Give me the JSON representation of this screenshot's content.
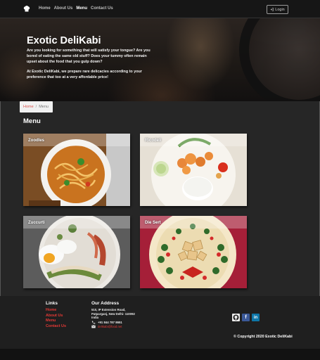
{
  "navbar": {
    "links": [
      {
        "label": "Home"
      },
      {
        "label": "About Us"
      },
      {
        "label": "Menu"
      },
      {
        "label": "Contact Us"
      }
    ],
    "login_label": "Login"
  },
  "hero": {
    "title": "Exotic DeliKabi",
    "paragraph1": "Are you looking for something that will satisfy your tongue? Are you bored of eating the same old stuff? Does your tummy often remain upset about the food that you gulp down?",
    "paragraph2": "At Exotic DeliKabi, we prepare rare delicacies according to your preference that too at a very affordable price!"
  },
  "breadcrumb": {
    "home": "Home",
    "separator": "/",
    "current": "Menu"
  },
  "menu": {
    "heading": "Menu",
    "items": [
      {
        "label": "Zoodles"
      },
      {
        "label": "Ricodeli"
      },
      {
        "label": "Zuccurti"
      },
      {
        "label": "Die Sert"
      }
    ]
  },
  "footer": {
    "links_title": "Links",
    "links": [
      "Home",
      "About Us",
      "Menu",
      "Contact Us"
    ],
    "address_title": "Our Address",
    "address": "510, IP Extension Road, Patparganj, New Delhi- 110092 India",
    "phone": "+91 844 787 8651",
    "email": "delikabi@food.net",
    "copyright": "© Copyright 2020 Exotic DeliKabi"
  },
  "colors": {
    "accent_red": "#e53935",
    "navbar_bg": "#161616",
    "footer_bg": "#1f1f1f",
    "body_bg": "#262626"
  }
}
